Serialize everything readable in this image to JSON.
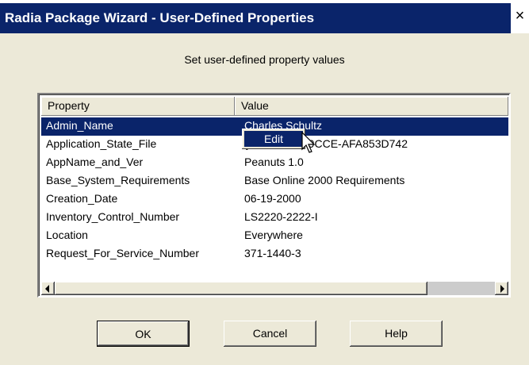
{
  "window": {
    "title": "Radia Package Wizard - User-Defined Properties",
    "close_glyph": "×"
  },
  "dialog": {
    "subtitle": "Set user-defined property values"
  },
  "table": {
    "columns": [
      "Property",
      "Value"
    ],
    "rows": [
      {
        "property": "Admin_Name",
        "value": "Charles Schultz",
        "selected": true
      },
      {
        "property": "Application_State_File",
        "value": "{...49A-4711-9CCE-AFA853D742"
      },
      {
        "property": "AppName_and_Ver",
        "value": "Peanuts 1.0"
      },
      {
        "property": "Base_System_Requirements",
        "value": "Base Online 2000 Requirements"
      },
      {
        "property": "Creation_Date",
        "value": "06-19-2000"
      },
      {
        "property": "Inventory_Control_Number",
        "value": "LS2220-2222-I"
      },
      {
        "property": "Location",
        "value": "Everywhere"
      },
      {
        "property": "Request_For_Service_Number",
        "value": "371-1440-3"
      }
    ]
  },
  "context_menu": {
    "items": [
      "Edit"
    ]
  },
  "buttons": {
    "ok": "OK",
    "cancel": "Cancel",
    "help": "Help"
  },
  "colors": {
    "titlebar": "#0a246a",
    "selection": "#0a246a",
    "face": "#ece9d8"
  }
}
